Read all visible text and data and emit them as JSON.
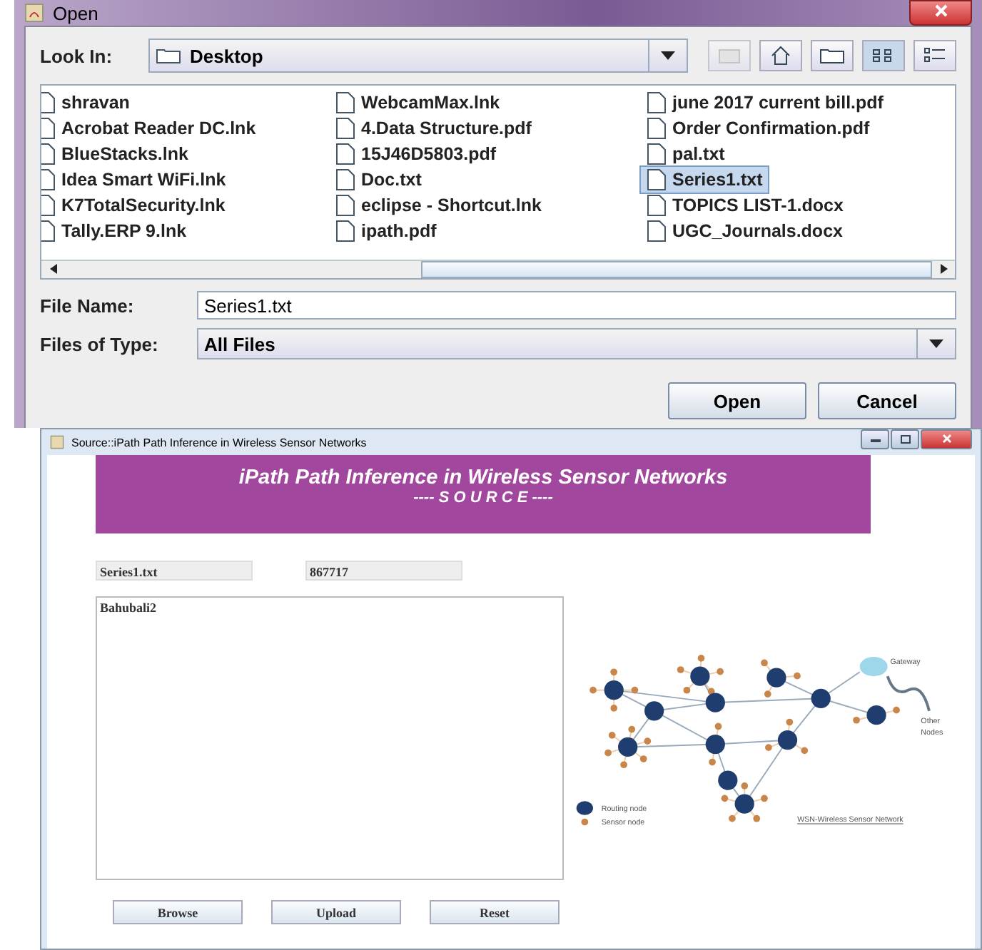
{
  "open_dialog": {
    "title": "Open",
    "look_in": {
      "label": "Look In:",
      "value": "Desktop"
    },
    "files": [
      {
        "name": "shravan",
        "selected": false
      },
      {
        "name": "Acrobat Reader DC.lnk",
        "selected": false
      },
      {
        "name": "BlueStacks.lnk",
        "selected": false
      },
      {
        "name": "Idea Smart WiFi.lnk",
        "selected": false
      },
      {
        "name": "K7TotalSecurity.lnk",
        "selected": false
      },
      {
        "name": "Tally.ERP 9.lnk",
        "selected": false
      },
      {
        "name": "WebcamMax.lnk",
        "selected": false
      },
      {
        "name": "4.Data Structure.pdf",
        "selected": false
      },
      {
        "name": "15J46D5803.pdf",
        "selected": false
      },
      {
        "name": "Doc.txt",
        "selected": false
      },
      {
        "name": "eclipse - Shortcut.lnk",
        "selected": false
      },
      {
        "name": "ipath.pdf",
        "selected": false
      },
      {
        "name": "june 2017 current bill.pdf",
        "selected": false
      },
      {
        "name": "Order Confirmation.pdf",
        "selected": false
      },
      {
        "name": "pal.txt",
        "selected": false
      },
      {
        "name": "Series1.txt",
        "selected": true
      },
      {
        "name": "TOPICS LIST-1.docx",
        "selected": false
      },
      {
        "name": "UGC_Journals.docx",
        "selected": false
      }
    ],
    "file_name": {
      "label": "File Name:",
      "value": "Series1.txt"
    },
    "file_type": {
      "label": "Files of Type:",
      "value": "All Files"
    },
    "buttons": [
      "Open",
      "Cancel"
    ]
  },
  "source_window": {
    "title": "Source::iPath Path Inference in Wireless Sensor Networks",
    "banner": {
      "title": "iPath Path Inference in Wireless Sensor Networks",
      "subtitle": "---- S O U R C E ----"
    },
    "file_field": "Series1.txt",
    "size_field": "867717",
    "content": "Bahubali2",
    "diagram": {
      "gateway": "Gateway",
      "other": [
        "Other",
        "Nodes"
      ],
      "legend": [
        "Routing node",
        "Sensor node"
      ],
      "caption": "WSN-Wireless Sensor Network"
    },
    "buttons": [
      "Browse",
      "Upload",
      "Reset"
    ]
  }
}
